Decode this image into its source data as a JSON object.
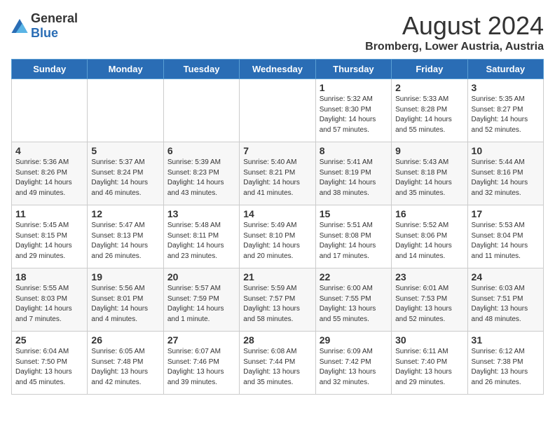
{
  "logo": {
    "general": "General",
    "blue": "Blue"
  },
  "title": "August 2024",
  "subtitle": "Bromberg, Lower Austria, Austria",
  "days_of_week": [
    "Sunday",
    "Monday",
    "Tuesday",
    "Wednesday",
    "Thursday",
    "Friday",
    "Saturday"
  ],
  "weeks": [
    [
      {
        "day": "",
        "info": ""
      },
      {
        "day": "",
        "info": ""
      },
      {
        "day": "",
        "info": ""
      },
      {
        "day": "",
        "info": ""
      },
      {
        "day": "1",
        "info": "Sunrise: 5:32 AM\nSunset: 8:30 PM\nDaylight: 14 hours and 57 minutes."
      },
      {
        "day": "2",
        "info": "Sunrise: 5:33 AM\nSunset: 8:28 PM\nDaylight: 14 hours and 55 minutes."
      },
      {
        "day": "3",
        "info": "Sunrise: 5:35 AM\nSunset: 8:27 PM\nDaylight: 14 hours and 52 minutes."
      }
    ],
    [
      {
        "day": "4",
        "info": "Sunrise: 5:36 AM\nSunset: 8:26 PM\nDaylight: 14 hours and 49 minutes."
      },
      {
        "day": "5",
        "info": "Sunrise: 5:37 AM\nSunset: 8:24 PM\nDaylight: 14 hours and 46 minutes."
      },
      {
        "day": "6",
        "info": "Sunrise: 5:39 AM\nSunset: 8:23 PM\nDaylight: 14 hours and 43 minutes."
      },
      {
        "day": "7",
        "info": "Sunrise: 5:40 AM\nSunset: 8:21 PM\nDaylight: 14 hours and 41 minutes."
      },
      {
        "day": "8",
        "info": "Sunrise: 5:41 AM\nSunset: 8:19 PM\nDaylight: 14 hours and 38 minutes."
      },
      {
        "day": "9",
        "info": "Sunrise: 5:43 AM\nSunset: 8:18 PM\nDaylight: 14 hours and 35 minutes."
      },
      {
        "day": "10",
        "info": "Sunrise: 5:44 AM\nSunset: 8:16 PM\nDaylight: 14 hours and 32 minutes."
      }
    ],
    [
      {
        "day": "11",
        "info": "Sunrise: 5:45 AM\nSunset: 8:15 PM\nDaylight: 14 hours and 29 minutes."
      },
      {
        "day": "12",
        "info": "Sunrise: 5:47 AM\nSunset: 8:13 PM\nDaylight: 14 hours and 26 minutes."
      },
      {
        "day": "13",
        "info": "Sunrise: 5:48 AM\nSunset: 8:11 PM\nDaylight: 14 hours and 23 minutes."
      },
      {
        "day": "14",
        "info": "Sunrise: 5:49 AM\nSunset: 8:10 PM\nDaylight: 14 hours and 20 minutes."
      },
      {
        "day": "15",
        "info": "Sunrise: 5:51 AM\nSunset: 8:08 PM\nDaylight: 14 hours and 17 minutes."
      },
      {
        "day": "16",
        "info": "Sunrise: 5:52 AM\nSunset: 8:06 PM\nDaylight: 14 hours and 14 minutes."
      },
      {
        "day": "17",
        "info": "Sunrise: 5:53 AM\nSunset: 8:04 PM\nDaylight: 14 hours and 11 minutes."
      }
    ],
    [
      {
        "day": "18",
        "info": "Sunrise: 5:55 AM\nSunset: 8:03 PM\nDaylight: 14 hours and 7 minutes."
      },
      {
        "day": "19",
        "info": "Sunrise: 5:56 AM\nSunset: 8:01 PM\nDaylight: 14 hours and 4 minutes."
      },
      {
        "day": "20",
        "info": "Sunrise: 5:57 AM\nSunset: 7:59 PM\nDaylight: 14 hours and 1 minute."
      },
      {
        "day": "21",
        "info": "Sunrise: 5:59 AM\nSunset: 7:57 PM\nDaylight: 13 hours and 58 minutes."
      },
      {
        "day": "22",
        "info": "Sunrise: 6:00 AM\nSunset: 7:55 PM\nDaylight: 13 hours and 55 minutes."
      },
      {
        "day": "23",
        "info": "Sunrise: 6:01 AM\nSunset: 7:53 PM\nDaylight: 13 hours and 52 minutes."
      },
      {
        "day": "24",
        "info": "Sunrise: 6:03 AM\nSunset: 7:51 PM\nDaylight: 13 hours and 48 minutes."
      }
    ],
    [
      {
        "day": "25",
        "info": "Sunrise: 6:04 AM\nSunset: 7:50 PM\nDaylight: 13 hours and 45 minutes."
      },
      {
        "day": "26",
        "info": "Sunrise: 6:05 AM\nSunset: 7:48 PM\nDaylight: 13 hours and 42 minutes."
      },
      {
        "day": "27",
        "info": "Sunrise: 6:07 AM\nSunset: 7:46 PM\nDaylight: 13 hours and 39 minutes."
      },
      {
        "day": "28",
        "info": "Sunrise: 6:08 AM\nSunset: 7:44 PM\nDaylight: 13 hours and 35 minutes."
      },
      {
        "day": "29",
        "info": "Sunrise: 6:09 AM\nSunset: 7:42 PM\nDaylight: 13 hours and 32 minutes."
      },
      {
        "day": "30",
        "info": "Sunrise: 6:11 AM\nSunset: 7:40 PM\nDaylight: 13 hours and 29 minutes."
      },
      {
        "day": "31",
        "info": "Sunrise: 6:12 AM\nSunset: 7:38 PM\nDaylight: 13 hours and 26 minutes."
      }
    ]
  ]
}
